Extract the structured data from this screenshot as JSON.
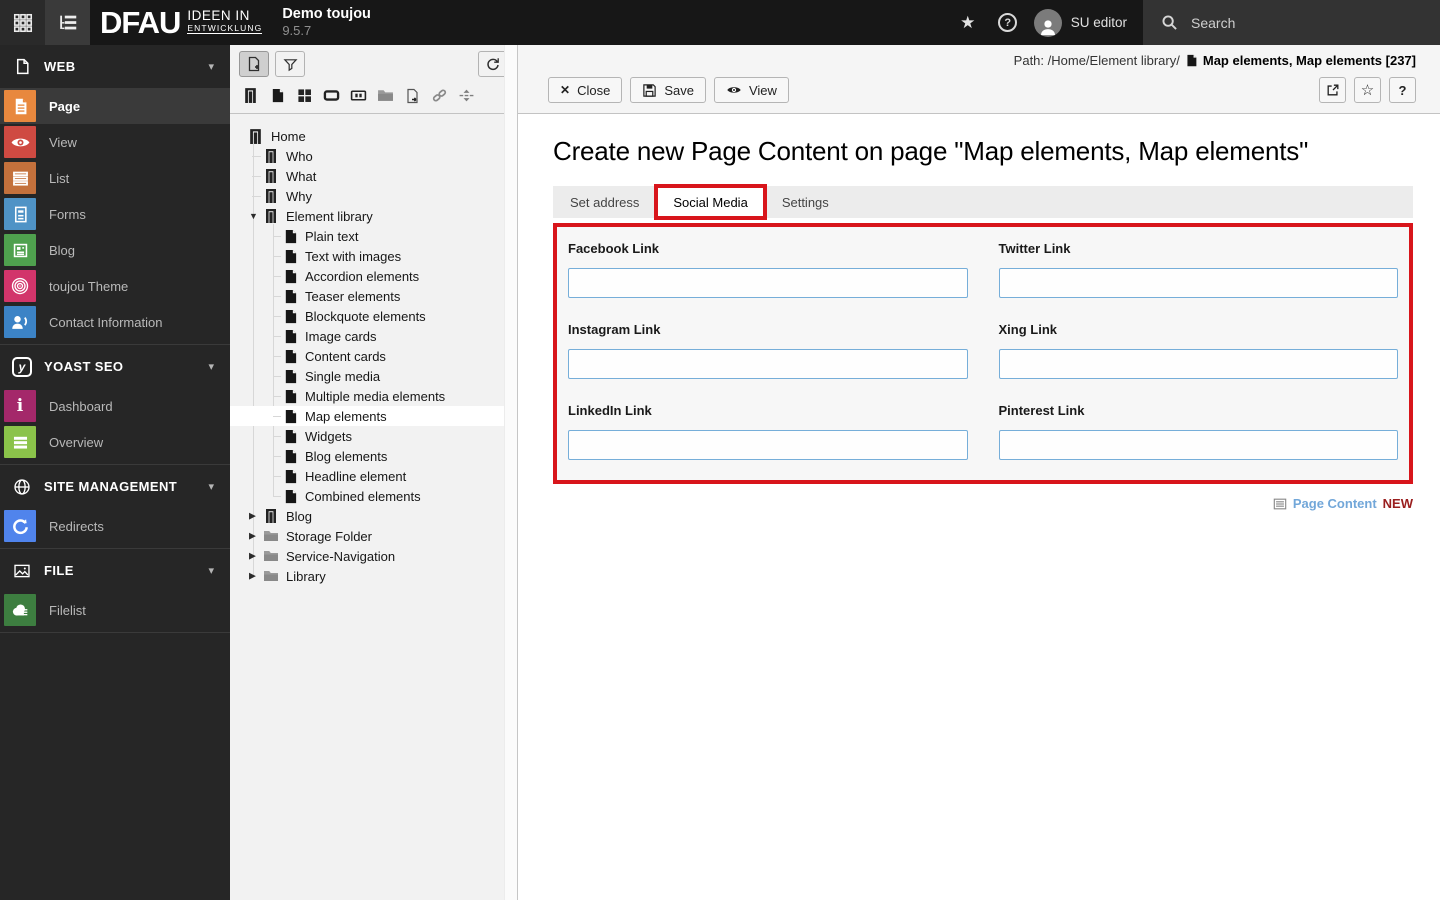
{
  "topbar": {
    "logo": "DFAU",
    "logo_sub1": "IDEEN IN",
    "logo_sub2": "ENTWICKLUNG",
    "site_name": "Demo toujou",
    "version": "9.5.7",
    "user": "SU editor",
    "search_label": "Search"
  },
  "sidebar": {
    "sections": [
      {
        "label": "WEB",
        "items": [
          {
            "label": "Page",
            "color": "#e8883e"
          },
          {
            "label": "View",
            "color": "#cf4a42"
          },
          {
            "label": "List",
            "color": "#c4713c"
          },
          {
            "label": "Forms",
            "color": "#4f93c6"
          },
          {
            "label": "Blog",
            "color": "#4fa14e"
          },
          {
            "label": "toujou Theme",
            "color": "#d2356b"
          },
          {
            "label": "Contact Information",
            "color": "#3c83c6"
          }
        ]
      },
      {
        "label": "YOAST SEO",
        "items": [
          {
            "label": "Dashboard",
            "color": "#a4286a"
          },
          {
            "label": "Overview",
            "color": "#8bc34a"
          }
        ]
      },
      {
        "label": "SITE MANAGEMENT",
        "items": [
          {
            "label": "Redirects",
            "color": "#5084ec"
          }
        ]
      },
      {
        "label": "FILE",
        "items": [
          {
            "label": "Filelist",
            "color": "#3d7e40"
          }
        ]
      }
    ]
  },
  "tree": {
    "items": [
      {
        "label": "Home"
      },
      {
        "label": "Who"
      },
      {
        "label": "What"
      },
      {
        "label": "Why"
      },
      {
        "label": "Element library"
      },
      {
        "label": "Plain text"
      },
      {
        "label": "Text with images"
      },
      {
        "label": "Accordion elements"
      },
      {
        "label": "Teaser elements"
      },
      {
        "label": "Blockquote elements"
      },
      {
        "label": "Image cards"
      },
      {
        "label": "Content cards"
      },
      {
        "label": "Single media"
      },
      {
        "label": "Multiple media elements"
      },
      {
        "label": "Map elements"
      },
      {
        "label": "Widgets"
      },
      {
        "label": "Blog elements"
      },
      {
        "label": "Headline element"
      },
      {
        "label": "Combined elements"
      },
      {
        "label": "Blog"
      },
      {
        "label": "Storage Folder"
      },
      {
        "label": "Service-Navigation"
      },
      {
        "label": "Library"
      }
    ]
  },
  "doc": {
    "path_prefix": "Path: /Home/Element library/",
    "path_page": "Map elements, Map elements [237]",
    "buttons": {
      "close": "Close",
      "save": "Save",
      "view": "View"
    },
    "title": "Create new Page Content on page \"Map elements, Map elements\"",
    "tabs": [
      {
        "label": "Set address"
      },
      {
        "label": "Social Media"
      },
      {
        "label": "Settings"
      }
    ],
    "fields": [
      "Facebook Link",
      "Twitter Link",
      "Instagram Link",
      "Xing Link",
      "LinkedIn Link",
      "Pinterest Link"
    ],
    "footer": {
      "type_label": "Page Content",
      "state_label": "NEW"
    }
  },
  "colors": {
    "annotation_red": "#d8151b",
    "record_type_blue": "#72a7d9",
    "new_marker_red": "#9a1f1f",
    "input_border_blue": "#76aed9"
  }
}
